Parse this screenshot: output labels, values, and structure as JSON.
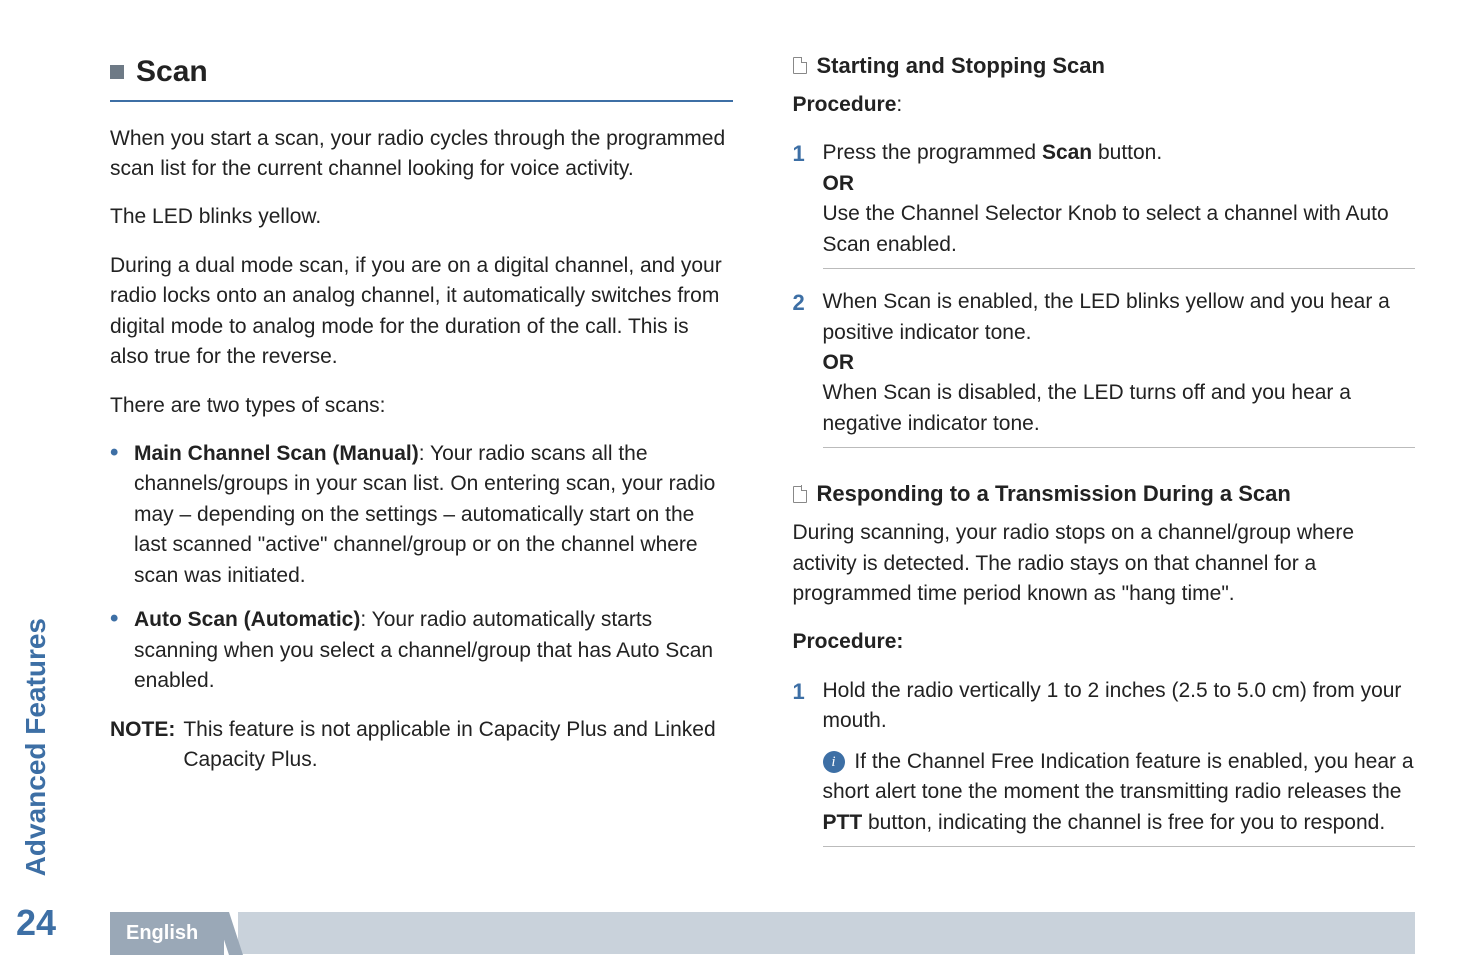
{
  "sidebar": {
    "section": "Advanced Features",
    "page_number": "24"
  },
  "footer": {
    "language": "English"
  },
  "left": {
    "section_title": "Scan",
    "p1": "When you start a scan, your radio cycles through the programmed scan list for the current channel looking for voice activity.",
    "p2": "The LED blinks yellow.",
    "p3": "During a dual mode scan, if you are on a digital channel, and your radio locks onto an analog channel, it automatically switches from digital mode to analog mode for the duration of the call. This is also true for the reverse.",
    "p4": "There are two types of scans:",
    "bullets": [
      {
        "title": "Main Channel Scan (Manual)",
        "rest": ": Your radio scans all the channels/groups in your scan list. On entering scan, your radio may – depending on the settings – automatically start on the last scanned \"active\" channel/group or on the channel where scan was initiated."
      },
      {
        "title": "Auto Scan (Automatic)",
        "rest": ": Your radio automatically starts scanning when you select a channel/group that has Auto Scan enabled."
      }
    ],
    "note_label": "NOTE:",
    "note_body": "This feature is not applicable in Capacity Plus and Linked Capacity Plus."
  },
  "right": {
    "sub1_title": "Starting and Stopping Scan",
    "procedure_label": "Procedure",
    "procedure_colon": ":",
    "step1_a": "Press the programmed ",
    "step1_scan": "Scan",
    "step1_b": " button.",
    "or": "OR",
    "step1_c": "Use the Channel Selector Knob to select a channel with Auto Scan enabled.",
    "step2_a": "When Scan is enabled, the LED blinks yellow and you hear a positive indicator tone.",
    "step2_b": "When Scan is disabled, the LED turns off and you hear a negative indicator tone.",
    "sub2_title": "Responding to a Transmission During a Scan",
    "sub2_p1": "During scanning, your radio stops on a channel/group where activity is detected. The radio stays on that channel for a programmed time period known as \"hang time\".",
    "procedure2_label": "Procedure:",
    "s2_step1": "Hold the radio vertically 1 to 2 inches (2.5 to 5.0 cm) from your mouth.",
    "s2_note_a": "If the Channel Free Indication feature is enabled, you hear a short alert tone the moment the transmitting radio releases the ",
    "s2_ptt": "PTT",
    "s2_note_b": " button, indicating the channel is free for you to respond."
  }
}
